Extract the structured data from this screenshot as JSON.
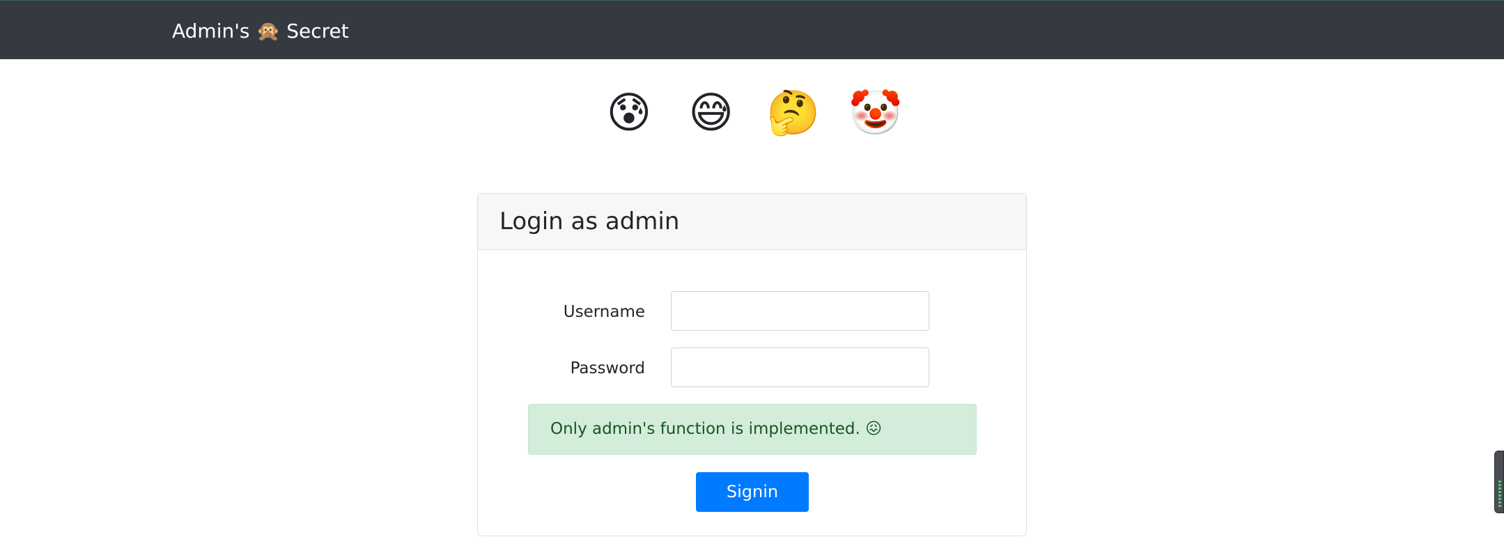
{
  "navbar": {
    "brand_prefix": "Admin's",
    "brand_emoji": "🙊",
    "brand_suffix": "Secret"
  },
  "emoji_row": [
    "😰",
    "😅",
    "🤔",
    "🤡"
  ],
  "login_card": {
    "title": "Login as admin",
    "username_label": "Username",
    "username_value": "",
    "password_label": "Password",
    "password_value": "",
    "alert_text": "Only admin's function is implemented.",
    "alert_emoji": "😖",
    "signin_label": "Signin"
  },
  "colors": {
    "navbar_bg": "#343a40",
    "primary": "#007bff",
    "alert_bg": "#d4edda",
    "alert_text": "#155724"
  }
}
